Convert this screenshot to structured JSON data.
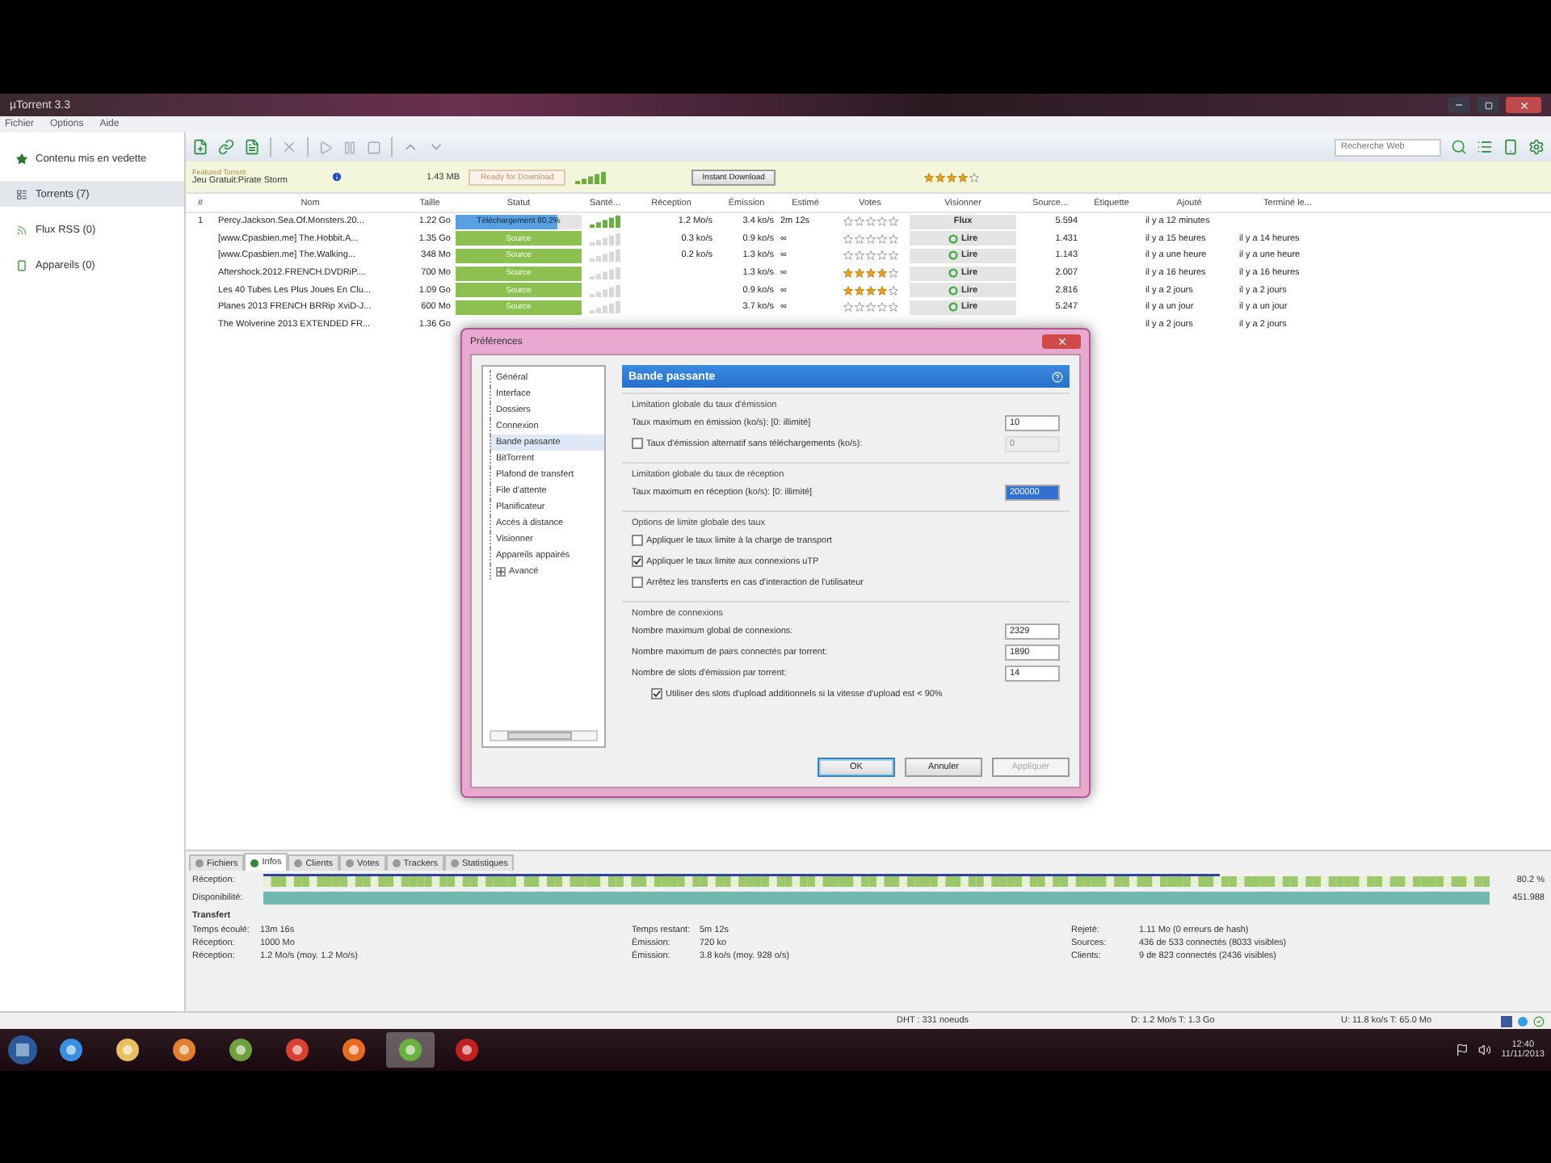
{
  "window": {
    "title": "µTorrent 3.3"
  },
  "menu": [
    "Fichier",
    "Options",
    "Aide"
  ],
  "sidebar": {
    "items": [
      {
        "label": "Contenu mis en vedette",
        "kind": "featured",
        "selected": false
      },
      {
        "label": "Torrents (7)",
        "kind": "torrents",
        "selected": true
      },
      {
        "label": "Flux RSS (0)",
        "kind": "rss",
        "selected": false
      },
      {
        "label": "Appareils (0)",
        "kind": "devices",
        "selected": false
      }
    ]
  },
  "toolbar": {
    "search": {
      "placeholder": "Recherche Web"
    }
  },
  "featured": {
    "caption": "Featured Torrent",
    "name": "Jeu Gratuit:Pirate Storm",
    "size": "1.43 MB",
    "ready_button": "Ready for Download",
    "ready_disabled": true,
    "instant_button": "Instant Download",
    "stars": 4
  },
  "table": {
    "columns": [
      "#",
      "Nom",
      "Taille",
      "Statut",
      "Santé...",
      "Réception",
      "Émission",
      "Estimé",
      "Votes",
      "Visionner",
      "Source...",
      "Étiquette",
      "Ajouté",
      "Terminé le..."
    ],
    "rows": [
      {
        "num": "1",
        "name": "Percy.Jackson.Sea.Of.Monsters.20...",
        "size": "1.22 Go",
        "status": {
          "kind": "downloading",
          "label": "Téléchargement 80.2%",
          "level": 0.802
        },
        "down": "1.2 Mo/s",
        "up": "3.4 ko/s",
        "eta": "2m 12s",
        "stars": 0,
        "watch": {
          "kind": "stream",
          "label": "Flux"
        },
        "sources": "5.594",
        "added": "il y a 12 minutes"
      },
      {
        "name": "[www.Cpasbien.me] The.Hobbit.A...",
        "size": "1.35 Go",
        "status": {
          "kind": "seeding",
          "label": "Source",
          "level": 1
        },
        "down": "0.3 ko/s",
        "up": "0.9 ko/s",
        "eta": "∞",
        "stars": 0,
        "watch": {
          "kind": "play",
          "label": "Lire"
        },
        "sources": "1.431",
        "added": "il y a 15 heures",
        "finished": "il y a 14 heures"
      },
      {
        "name": "[www.Cpasbien.me] The.Walking...",
        "size": "348 Mo",
        "status": {
          "kind": "seeding",
          "label": "Source",
          "level": 1
        },
        "down": "0.2 ko/s",
        "up": "1.3 ko/s",
        "eta": "∞",
        "stars": 0,
        "watch": {
          "kind": "play",
          "label": "Lire"
        },
        "sources": "1.143",
        "added": "il y a une heure",
        "finished": "il y a une heure"
      },
      {
        "name": "Aftershock.2012.FRENCH.DVDRiP....",
        "size": "700 Mo",
        "status": {
          "kind": "seeding",
          "label": "Source",
          "level": 1
        },
        "up": "1.3 ko/s",
        "eta": "∞",
        "stars": 4,
        "watch": {
          "kind": "play",
          "label": "Lire"
        },
        "sources": "2.007",
        "added": "il y a 16 heures",
        "finished": "il y a 16 heures"
      },
      {
        "name": "Les 40 Tubes Les Plus Joues En Clu...",
        "size": "1.09 Go",
        "status": {
          "kind": "seeding",
          "label": "Source",
          "level": 1
        },
        "up": "0.9 ko/s",
        "eta": "∞",
        "stars": 4,
        "watch": {
          "kind": "play",
          "label": "Lire"
        },
        "sources": "2.816",
        "added": "il y a 2 jours",
        "finished": "il y a 2 jours"
      },
      {
        "name": "Planes 2013 FRENCH BRRip XviD-J...",
        "size": "600 Mo",
        "status": {
          "kind": "seeding",
          "label": "Source",
          "level": 1
        },
        "up": "3.7 ko/s",
        "eta": "∞",
        "stars": 0,
        "watch": {
          "kind": "play",
          "label": "Lire"
        },
        "sources": "5.247",
        "added": "il y a un jour",
        "finished": "il y a un jour"
      },
      {
        "name": "The Wolverine 2013 EXTENDED FR...",
        "size": "1.36 Go",
        "added": "il y a 2 jours",
        "finished": "il y a 2 jours"
      }
    ]
  },
  "details": {
    "tabs": [
      {
        "label": "Fichiers",
        "selected": false
      },
      {
        "label": "Infos",
        "selected": true
      },
      {
        "label": "Clients",
        "selected": false
      },
      {
        "label": "Votes",
        "selected": false
      },
      {
        "label": "Trackers",
        "selected": false
      },
      {
        "label": "Statistiques",
        "selected": false
      }
    ],
    "pieces": {
      "label": "Réception:",
      "reading": "80.2 %",
      "level": 0.78
    },
    "availability": {
      "label": "Disponibilité:",
      "reading": "451.988"
    },
    "section": "Transfert",
    "fields": [
      {
        "label": "Temps écoulé:",
        "value": "13m 16s"
      },
      {
        "label": "Temps restant:",
        "value": "5m 12s"
      },
      {
        "label": "Rejeté:",
        "value": "1.11 Mo (0 erreurs de hash)"
      },
      {
        "label": "Réception:",
        "value": "1000 Mo"
      },
      {
        "label": "Émission:",
        "value": "720 ko"
      },
      {
        "label": "Sources:",
        "value": "436 de 533 connectés (8033 visibles)"
      },
      {
        "label": "Réception:",
        "value": "1.2 Mo/s (moy. 1.2 Mo/s)"
      },
      {
        "label": "Émission:",
        "value": "3.8 ko/s (moy. 928 o/s)"
      },
      {
        "label": "Clients:",
        "value": "9 de 823 connectés (2436 visibles)"
      }
    ]
  },
  "status_bar": {
    "dht": "DHT : 331 noeuds",
    "download": "D: 1.2 Mo/s T: 1.3 Go",
    "upload": "U: 11.8 ko/s T: 65.0 Mo"
  },
  "dialog": {
    "title": "Préférences",
    "tree": [
      {
        "label": "Général",
        "selected": false
      },
      {
        "label": "Interface",
        "selected": false
      },
      {
        "label": "Dossiers",
        "selected": false
      },
      {
        "label": "Connexion",
        "selected": false
      },
      {
        "label": "Bande passante",
        "selected": true
      },
      {
        "label": "BitTorrent",
        "selected": false
      },
      {
        "label": "Plafond de transfert",
        "selected": false
      },
      {
        "label": "File d'attente",
        "selected": false
      },
      {
        "label": "Planificateur",
        "selected": false
      },
      {
        "label": "Accès à distance",
        "selected": false
      },
      {
        "label": "Visionner",
        "selected": false
      },
      {
        "label": "Appareils appairés",
        "selected": false
      },
      {
        "label": "Avancé",
        "selected": false,
        "expandable": true
      }
    ],
    "heading": "Bande passante",
    "sections": [
      {
        "title": "Limitation globale du taux d'émission",
        "rows": [
          {
            "kind": "field",
            "label": "Taux maximum en émission (ko/s): [0: illimité]",
            "value": "10",
            "disabled": false,
            "highlighted": false
          },
          {
            "kind": "check_field",
            "label": "Taux d'émission alternatif sans téléchargements (ko/s):",
            "checked": false,
            "value": "0",
            "disabled": true,
            "highlighted": false
          }
        ]
      },
      {
        "title": "Limitation globale du taux de réception",
        "rows": [
          {
            "kind": "field",
            "label": "Taux maximum en réception (ko/s): [0: illimité]",
            "value": "200000",
            "disabled": false,
            "highlighted": true
          }
        ]
      },
      {
        "title": "Options de limite globale des taux",
        "rows": [
          {
            "kind": "check",
            "label": "Appliquer le taux limite à la charge de transport",
            "checked": false
          },
          {
            "kind": "check",
            "label": "Appliquer le taux limite aux connexions uTP",
            "checked": true
          },
          {
            "kind": "check",
            "label": "Arrêtez les transferts en cas d'interaction de l'utilisateur",
            "checked": false
          }
        ]
      },
      {
        "title": "Nombre de connexions",
        "rows": [
          {
            "kind": "field",
            "label": "Nombre maximum global de connexions:",
            "value": "2329",
            "disabled": false,
            "highlighted": false
          },
          {
            "kind": "field",
            "label": "Nombre maximum de pairs connectés par torrent:",
            "value": "1890",
            "disabled": false,
            "highlighted": false
          },
          {
            "kind": "field",
            "label": "Nombre de slots d'émission par torrent:",
            "value": "14",
            "disabled": false,
            "highlighted": false
          },
          {
            "kind": "subcheck",
            "label": "Utiliser des slots d'upload additionnels si la vitesse d'upload est < 90%",
            "checked": true
          }
        ]
      }
    ],
    "buttons": [
      {
        "label": "OK",
        "default": true,
        "disabled": false
      },
      {
        "label": "Annuler",
        "default": false,
        "disabled": false
      },
      {
        "label": "Appliquer",
        "default": false,
        "disabled": true
      }
    ]
  },
  "taskbar": {
    "apps": [
      {
        "kind": "ie",
        "selected": false
      },
      {
        "kind": "folder",
        "selected": false
      },
      {
        "kind": "media",
        "selected": false
      },
      {
        "kind": "tool",
        "selected": false
      },
      {
        "kind": "chrome",
        "selected": false
      },
      {
        "kind": "firefox",
        "selected": false
      },
      {
        "kind": "utorrent",
        "selected": true
      },
      {
        "kind": "game",
        "selected": false
      }
    ],
    "time": "12:40",
    "date": "11/11/2013"
  }
}
